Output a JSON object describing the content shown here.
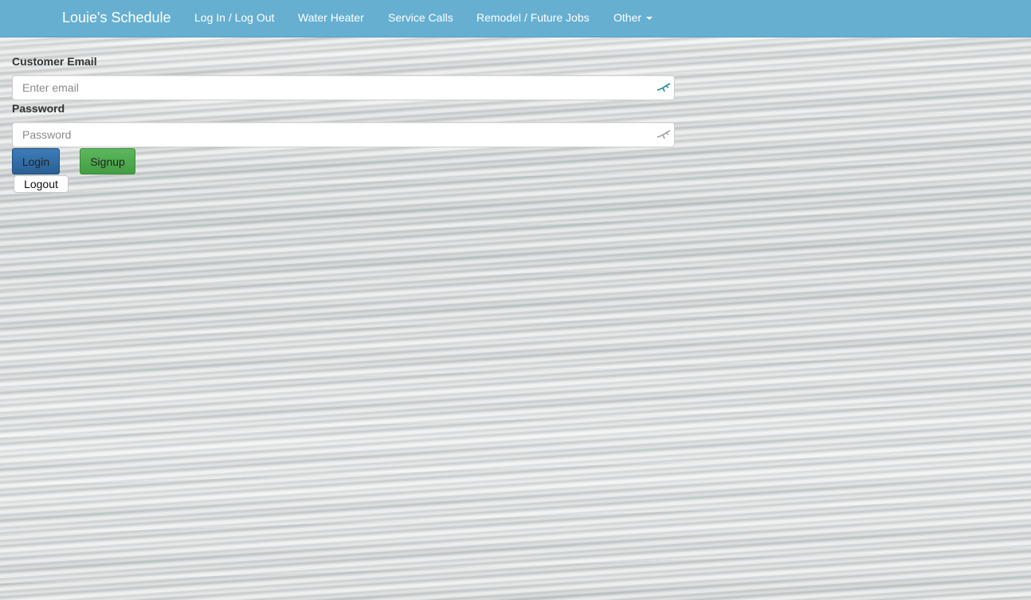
{
  "navbar": {
    "brand": "Louie's Schedule",
    "links": [
      {
        "label": "Log In / Log Out"
      },
      {
        "label": "Water Heater"
      },
      {
        "label": "Service Calls"
      },
      {
        "label": "Remodel / Future Jobs"
      },
      {
        "label": "Other"
      }
    ],
    "color": "#66afd1"
  },
  "form": {
    "email_label": "Customer Email",
    "email_placeholder": "Enter email",
    "email_value": "",
    "password_label": "Password",
    "password_placeholder": "Password",
    "password_value": "",
    "login_label": "Login",
    "signup_label": "Signup",
    "logout_label": "Logout"
  },
  "colors": {
    "login_button": "#2a5f96",
    "signup_button": "#449d44"
  }
}
